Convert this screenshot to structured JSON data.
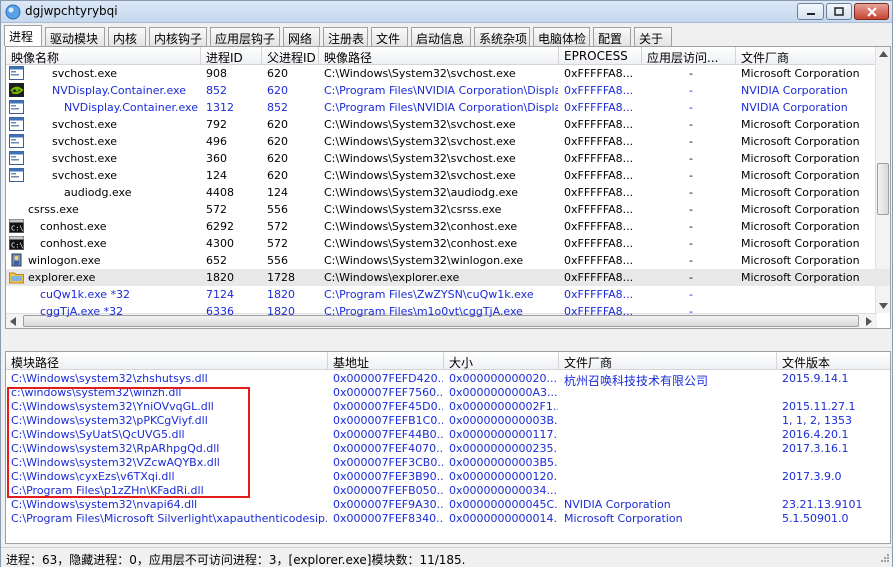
{
  "window": {
    "title": "dgjwpchtyrybqi"
  },
  "tabs": [
    "进程",
    "驱动模块",
    "内核",
    "内核钩子",
    "应用层钩子",
    "网络",
    "注册表",
    "文件",
    "启动信息",
    "系统杂项",
    "电脑体检",
    "配置",
    "关于"
  ],
  "process_table": {
    "columns": [
      "映像名称",
      "进程ID",
      "父进程ID",
      "映像路径",
      "EPROCESS",
      "应用层访问...",
      "文件厂商"
    ],
    "rows": [
      {
        "name": "svchost.exe",
        "pid": "908",
        "ppid": "620",
        "path": "C:\\Windows\\System32\\svchost.exe",
        "eprocess": "0xFFFFFA8...",
        "access": "-",
        "vendor": "Microsoft Corporation",
        "icon": "app-window-icon",
        "indent": 2,
        "blue": false
      },
      {
        "name": "NVDisplay.Container.exe",
        "pid": "852",
        "ppid": "620",
        "path": "C:\\Program Files\\NVIDIA Corporation\\Display...",
        "eprocess": "0xFFFFFA8...",
        "access": "-",
        "vendor": "NVIDIA Corporation",
        "icon": "nvidia-icon",
        "indent": 2,
        "blue": true
      },
      {
        "name": "NVDisplay.Container.exe",
        "pid": "1312",
        "ppid": "852",
        "path": "C:\\Program Files\\NVIDIA Corporation\\Display...",
        "eprocess": "0xFFFFFA8...",
        "access": "-",
        "vendor": "NVIDIA Corporation",
        "icon": "app-window-icon",
        "indent": 3,
        "blue": true
      },
      {
        "name": "svchost.exe",
        "pid": "792",
        "ppid": "620",
        "path": "C:\\Windows\\System32\\svchost.exe",
        "eprocess": "0xFFFFFA8...",
        "access": "-",
        "vendor": "Microsoft Corporation",
        "icon": "app-window-icon",
        "indent": 2,
        "blue": false
      },
      {
        "name": "svchost.exe",
        "pid": "496",
        "ppid": "620",
        "path": "C:\\Windows\\System32\\svchost.exe",
        "eprocess": "0xFFFFFA8...",
        "access": "-",
        "vendor": "Microsoft Corporation",
        "icon": "app-window-icon",
        "indent": 2,
        "blue": false
      },
      {
        "name": "svchost.exe",
        "pid": "360",
        "ppid": "620",
        "path": "C:\\Windows\\System32\\svchost.exe",
        "eprocess": "0xFFFFFA8...",
        "access": "-",
        "vendor": "Microsoft Corporation",
        "icon": "app-window-icon",
        "indent": 2,
        "blue": false
      },
      {
        "name": "svchost.exe",
        "pid": "124",
        "ppid": "620",
        "path": "C:\\Windows\\System32\\svchost.exe",
        "eprocess": "0xFFFFFA8...",
        "access": "-",
        "vendor": "Microsoft Corporation",
        "icon": "app-window-icon",
        "indent": 2,
        "blue": false
      },
      {
        "name": "audiodg.exe",
        "pid": "4408",
        "ppid": "124",
        "path": "C:\\Windows\\System32\\audiodg.exe",
        "eprocess": "0xFFFFFA8...",
        "access": "-",
        "vendor": "Microsoft Corporation",
        "icon": "",
        "indent": 3,
        "blue": false
      },
      {
        "name": "csrss.exe",
        "pid": "572",
        "ppid": "556",
        "path": "C:\\Windows\\System32\\csrss.exe",
        "eprocess": "0xFFFFFA8...",
        "access": "-",
        "vendor": "Microsoft Corporation",
        "icon": "",
        "indent": 0,
        "blue": false
      },
      {
        "name": "conhost.exe",
        "pid": "6292",
        "ppid": "572",
        "path": "C:\\Windows\\System32\\conhost.exe",
        "eprocess": "0xFFFFFA8...",
        "access": "-",
        "vendor": "Microsoft Corporation",
        "icon": "console-icon",
        "indent": 1,
        "blue": false
      },
      {
        "name": "conhost.exe",
        "pid": "4300",
        "ppid": "572",
        "path": "C:\\Windows\\System32\\conhost.exe",
        "eprocess": "0xFFFFFA8...",
        "access": "-",
        "vendor": "Microsoft Corporation",
        "icon": "console-icon",
        "indent": 1,
        "blue": false
      },
      {
        "name": "winlogon.exe",
        "pid": "652",
        "ppid": "556",
        "path": "C:\\Windows\\System32\\winlogon.exe",
        "eprocess": "0xFFFFFA8...",
        "access": "-",
        "vendor": "Microsoft Corporation",
        "icon": "winlogon-icon",
        "indent": 0,
        "blue": false
      },
      {
        "name": "explorer.exe",
        "pid": "1820",
        "ppid": "1728",
        "path": "C:\\Windows\\explorer.exe",
        "eprocess": "0xFFFFFA8...",
        "access": "-",
        "vendor": "Microsoft Corporation",
        "icon": "folder-icon",
        "indent": 0,
        "blue": false,
        "selected": true
      },
      {
        "name": "cuQw1k.exe *32",
        "pid": "7124",
        "ppid": "1820",
        "path": "C:\\Program Files\\ZwZYSN\\cuQw1k.exe",
        "eprocess": "0xFFFFFA8...",
        "access": "-",
        "vendor": "",
        "icon": "",
        "indent": 1,
        "blue": true
      },
      {
        "name": "cggTjA.exe *32",
        "pid": "6336",
        "ppid": "1820",
        "path": "C:\\Program Files\\m1o0vt\\cggTjA.exe",
        "eprocess": "0xFFFFFA8...",
        "access": "-",
        "vendor": "",
        "icon": "",
        "indent": 1,
        "blue": true
      }
    ]
  },
  "module_table": {
    "columns": [
      "模块路径",
      "基地址",
      "大小",
      "文件厂商",
      "文件版本"
    ],
    "rows": [
      {
        "path": "C:\\Windows\\system32\\zhshutsys.dll",
        "base": "0x000007FEFD420...",
        "size": "0x000000000020...",
        "vendor": "杭州召唤科技技术有限公司",
        "version": "2015.9.14.1"
      },
      {
        "path": "c:\\windows\\system32\\winzh.dll",
        "base": "0x000007FEF7560...",
        "size": "0x0000000000A3...",
        "vendor": "",
        "version": ""
      },
      {
        "path": "C:\\Windows\\system32\\YniOVvqGL.dll",
        "base": "0x000007FEF45D0...",
        "size": "0x00000000002F1...",
        "vendor": "",
        "version": "2015.11.27.1"
      },
      {
        "path": "C:\\Windows\\system32\\pPKCgViyf.dll",
        "base": "0x000007FEFB1C0...",
        "size": "0x000000000003B...",
        "vendor": "",
        "version": "1, 1, 2, 1353"
      },
      {
        "path": "C:\\Windows\\SyUatS\\QcUVG5.dll",
        "base": "0x000007FEF44B0...",
        "size": "0x0000000000117...",
        "vendor": "",
        "version": "2016.4.20.1"
      },
      {
        "path": "C:\\Windows\\system32\\RpARhpgQd.dll",
        "base": "0x000007FEF4070...",
        "size": "0x0000000000235...",
        "vendor": "",
        "version": "2017.3.16.1"
      },
      {
        "path": "C:\\Windows\\system32\\VZcwAQYBx.dll",
        "base": "0x000007FEF3CB0...",
        "size": "0x00000000003B5...",
        "vendor": "",
        "version": ""
      },
      {
        "path": "C:\\Windows\\cyxEzs\\v6TXqi.dll",
        "base": "0x000007FEF3B90...",
        "size": "0x0000000000120...",
        "vendor": "",
        "version": "2017.3.9.0"
      },
      {
        "path": "C:\\Program Files\\p1zZHn\\KFadRi.dll",
        "base": "0x000007FEFB050...",
        "size": "0x000000000034...",
        "vendor": "",
        "version": ""
      },
      {
        "path": "C:\\Windows\\system32\\nvapi64.dll",
        "base": "0x000007FEF9A30...",
        "size": "0x000000000045C...",
        "vendor": "NVIDIA Corporation",
        "version": "23.21.13.9101"
      },
      {
        "path": "C:\\Program Files\\Microsoft Silverlight\\xapauthenticodesip.dll",
        "base": "0x000007FEF8340...",
        "size": "0x0000000000014...",
        "vendor": " Microsoft Corporation",
        "version": "5.1.50901.0"
      }
    ]
  },
  "statusbar": {
    "text": "进程：63，隐藏进程：0，应用层不可访问进程：3，[explorer.exe]模块数：11/185."
  },
  "colors": {
    "link_blue": "#1a2bd8",
    "highlight_red": "#e21b1b",
    "selection": "#e8e8e8"
  }
}
